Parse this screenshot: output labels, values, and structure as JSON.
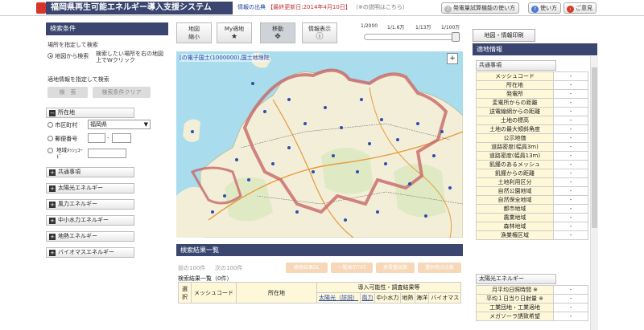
{
  "header": {
    "app_title": "福岡県再生可能エネルギー導入支援システム",
    "info_prefix": "情報の出典",
    "info_date": "【最終更新日:2014年4月10日】",
    "info_note": "（※の説明はこちら）",
    "buttons": [
      {
        "label": "発電量試算機能の使い方",
        "icon": "question-icon",
        "color": "#bbbbbb"
      },
      {
        "label": "使い方",
        "icon": "question-icon",
        "color": "#4a7bd0"
      },
      {
        "label": "ご意見",
        "icon": "arrow-circle-icon",
        "color": "#d83a2a"
      }
    ]
  },
  "left": {
    "title": "検索条件",
    "place_heading": "場所を指定して検索",
    "radio_map": "地図から検索",
    "radio_map_hint": "検索したい場所を右の地図上でWクリック",
    "info_heading": "適地情報を指定して検索",
    "search_btn": "検　索",
    "clear_btn": "検索条件クリア",
    "location_section": "所在地",
    "city_label": "市区町村",
    "city_value": "福岡県",
    "postal_label": "郵便番号",
    "postal_sep": "-",
    "mesh_label": "地域ﾒｯｼｭｺｰﾄﾞ",
    "sections": [
      "共通事項",
      "太陽光エネルギー",
      "風力エネルギー",
      "中小水力エネルギー",
      "地熱エネルギー",
      "バイオマスエネルギー"
    ]
  },
  "toolbar": {
    "buttons": [
      {
        "label": "地図",
        "sub": "縮小",
        "icon": "zoom-out-icon",
        "glyph": ""
      },
      {
        "label": "My適地",
        "sub": "",
        "icon": "star-icon",
        "glyph": "★"
      },
      {
        "label": "移動",
        "sub": "",
        "icon": "move-icon",
        "glyph": "✥"
      },
      {
        "label": "情報表示",
        "sub": "",
        "icon": "info-icon",
        "glyph": "ⓘ"
      }
    ],
    "scale_labels": [
      "1/2000",
      "1/1.6万",
      "1/13万",
      "1/100万"
    ]
  },
  "map": {
    "caption": "[の電子国土(1000000),国土地理院"
  },
  "results": {
    "title": "検索結果一覧",
    "prev": "前の100件",
    "next": "次の100件",
    "action_buttons": [
      "検索結果DL",
      "一覧表示TXT",
      "発電量試算",
      "選択地点比較"
    ],
    "count": "検索結果一覧（0件）",
    "headers": {
      "select": "選択",
      "mesh": "メッシュコード",
      "location": "所在地",
      "group": "導入可能性・調査結果等",
      "solar": "太陽光（詳説）",
      "wind": "風力",
      "hydro": "中小水力",
      "geo": "地熱",
      "ocean": "海洋",
      "bio": "バイオマス"
    }
  },
  "right": {
    "print_btn": "地図・情報印刷",
    "title": "適地情報",
    "common_cat": "共通事項",
    "common_items": [
      {
        "k": "メッシュコード",
        "v": "-"
      },
      {
        "k": "所在地",
        "v": "-"
      },
      {
        "k": "発電所",
        "v": "-"
      },
      {
        "k": "変電所からの距離",
        "v": "-"
      },
      {
        "k": "送電線網からの距離",
        "v": "-"
      },
      {
        "k": "土地の標高",
        "v": "-"
      },
      {
        "k": "土地の最大傾斜角度",
        "v": "-"
      },
      {
        "k": "公示地価",
        "v": "-"
      },
      {
        "k": "道路密度(幅員3m)",
        "v": "-"
      },
      {
        "k": "道路密度(幅員13m)",
        "v": "-"
      },
      {
        "k": "飢饉のあるメッシュ",
        "v": "-"
      },
      {
        "k": "飢饉からの距離",
        "v": "-"
      },
      {
        "k": "土地利用区分",
        "v": "-"
      },
      {
        "k": "自然公園地域",
        "v": "-"
      },
      {
        "k": "自然保全地域",
        "v": "-"
      },
      {
        "k": "都市地域",
        "v": "-"
      },
      {
        "k": "農業地域",
        "v": "-"
      },
      {
        "k": "森林地域",
        "v": "-"
      },
      {
        "k": "漁業権区域",
        "v": "-"
      }
    ],
    "solar_cat": "太陽光エネルギー",
    "solar_items": [
      {
        "k": "月平均日照時間 ※",
        "v": "-"
      },
      {
        "k": "平均１日当り日射量 ※",
        "v": "-"
      },
      {
        "k": "工業団地・工業適地",
        "v": "-"
      },
      {
        "k": "メガソーラ誘致希望",
        "v": "-"
      }
    ]
  }
}
